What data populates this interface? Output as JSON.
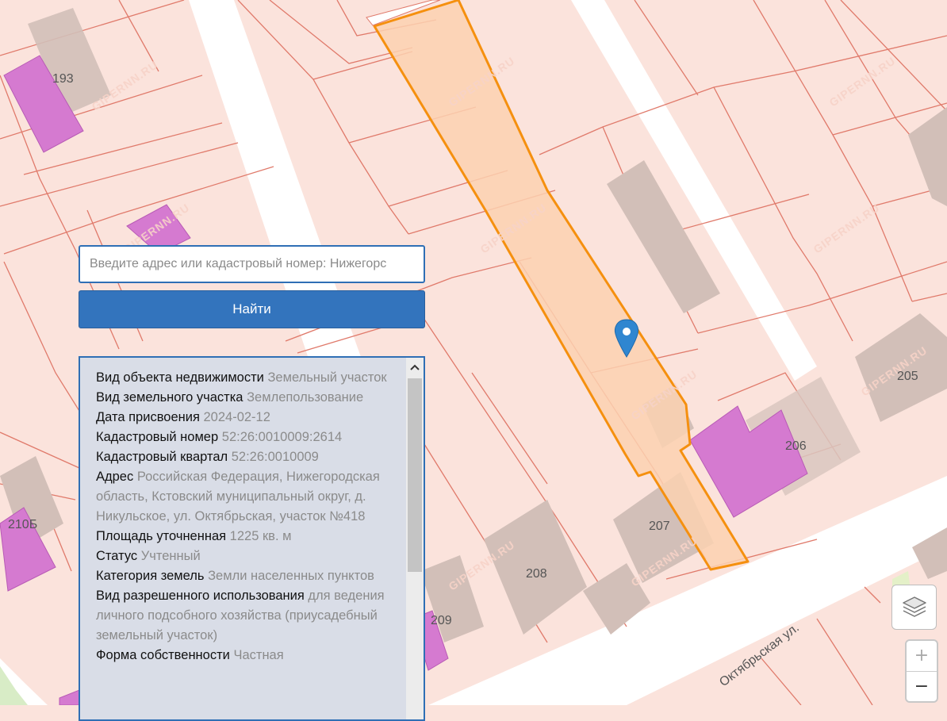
{
  "search": {
    "placeholder": "Введите адрес или кадастровый номер: Нижегорс",
    "value": "",
    "button_label": "Найти"
  },
  "info": [
    {
      "label": "Вид объекта недвижимости",
      "value": "Земельный участок"
    },
    {
      "label": "Вид земельного участка",
      "value": "Землепользование"
    },
    {
      "label": "Дата присвоения",
      "value": "2024-02-12"
    },
    {
      "label": "Кадастровый номер",
      "value": "52:26:0010009:2614"
    },
    {
      "label": "Кадастровый квартал",
      "value": "52:26:0010009"
    },
    {
      "label": "Адрес",
      "value": "Российская Федерация, Нижегородская область, Кстовский муниципальный округ, д. Никульское, ул. Октябрьская, участок №418"
    },
    {
      "label": "Площадь уточненная",
      "value": "1225 кв. м"
    },
    {
      "label": "Статус",
      "value": "Учтенный"
    },
    {
      "label": "Категория земель",
      "value": "Земли населенных пунктов"
    },
    {
      "label": "Вид разрешенного использования",
      "value": "для ведения личного подсобного хозяйства (приусадебный земельный участок)"
    },
    {
      "label": "Форма собственности",
      "value": "Частная"
    }
  ],
  "map": {
    "house_numbers": [
      "193",
      "205",
      "206",
      "207",
      "208",
      "209",
      "210Б"
    ],
    "street_name": "Октябрьская ул.",
    "watermark": "GIPERNN.RU",
    "colors": {
      "background": "#fbe3dc",
      "road": "#ffffff",
      "parcel_line": "#e07a6b",
      "building": "#d2bfb8",
      "building_highlight": "#d57ad0",
      "selected_fill": "#fbd1b0",
      "selected_stroke": "#f5900f",
      "marker": "#2f86d0",
      "button": "#3374bd"
    },
    "icons": [
      "map-marker-icon",
      "layers-icon",
      "scroll-up-arrow-icon"
    ]
  },
  "controls": {
    "zoom_in": "+",
    "zoom_out": "−"
  }
}
